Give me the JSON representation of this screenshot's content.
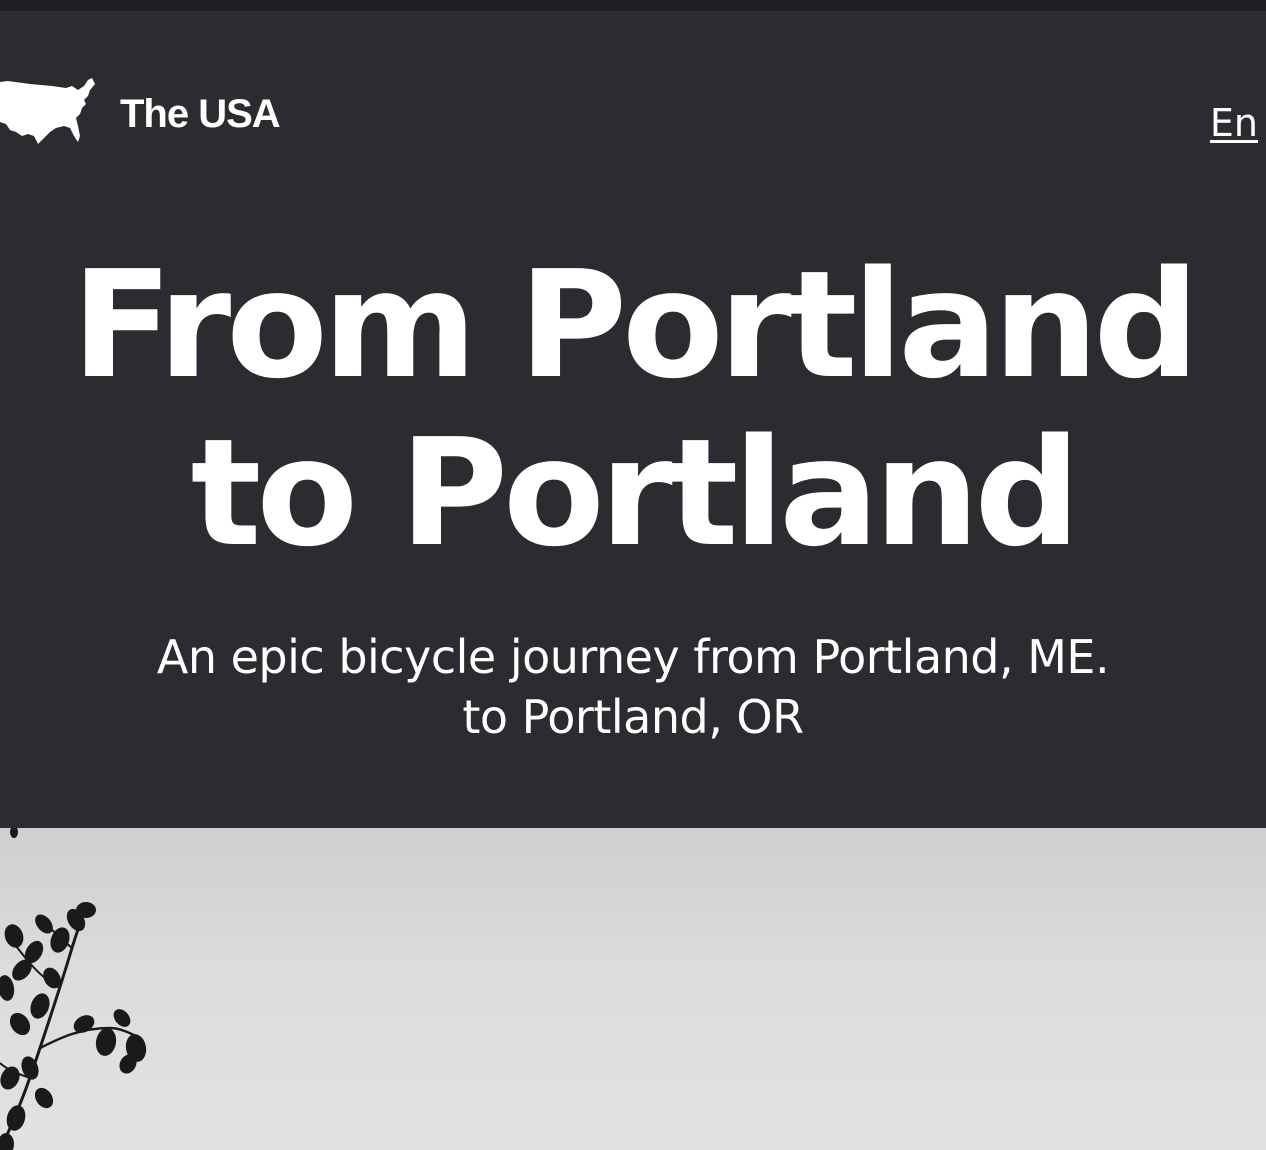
{
  "header": {
    "logo_text": "The USA",
    "logo_icon": "usa-map-icon",
    "language_link": "En"
  },
  "hero": {
    "title_line1": "From Portland",
    "title_line2": "to Portland",
    "subtitle_line1": "An epic bicycle journey from Portland, ME.",
    "subtitle_line2": "to Portland, OR"
  },
  "photo": {
    "icon": "tree-branch-silhouette"
  },
  "colors": {
    "hero_background": "#2b2c30",
    "text": "#ffffff",
    "photo_sky": "#dcdcdc"
  }
}
